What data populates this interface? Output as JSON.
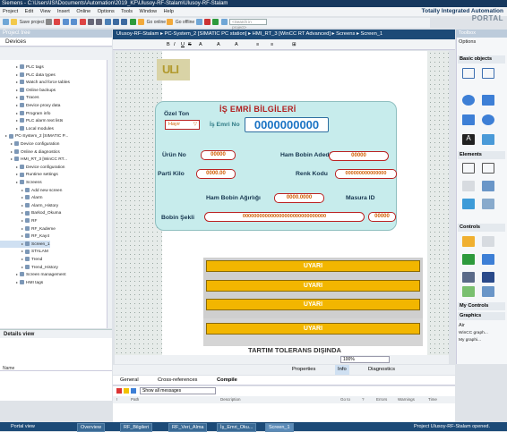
{
  "window": {
    "title": "Siemens - C:\\Users\\ISI\\Documents\\Automation\\2019_KF\\Ulusoy-RF-Stalam\\Ulusoy-RF-Stalam"
  },
  "menu": [
    "Project",
    "Edit",
    "View",
    "Insert",
    "Online",
    "Options",
    "Tools",
    "Window",
    "Help"
  ],
  "brand": {
    "line1": "Totally Integrated Automation",
    "line2": "PORTAL"
  },
  "toolbar": {
    "save": "Save project",
    "go_online": "Go online",
    "go_offline": "Go offline",
    "search_placeholder": "<Search in project>"
  },
  "project_panel": {
    "title": "Project tree",
    "devices_tab": "Devices"
  },
  "tree": [
    {
      "label": "PLC tags",
      "indent": 2
    },
    {
      "label": "PLC data types",
      "indent": 2
    },
    {
      "label": "Watch and force tables",
      "indent": 2
    },
    {
      "label": "Online backups",
      "indent": 2
    },
    {
      "label": "Traces",
      "indent": 2
    },
    {
      "label": "Device proxy data",
      "indent": 2
    },
    {
      "label": "Program info",
      "indent": 2
    },
    {
      "label": "PLC alarm text lists",
      "indent": 2
    },
    {
      "label": "Local modules",
      "indent": 2
    },
    {
      "label": "PC-System_2 [SIMATIC P...",
      "indent": 0
    },
    {
      "label": "Device configuration",
      "indent": 1
    },
    {
      "label": "Online & diagnostics",
      "indent": 1
    },
    {
      "label": "HMI_RT_3 [WinCC RT...",
      "indent": 1
    },
    {
      "label": "Device configuration",
      "indent": 2
    },
    {
      "label": "Runtime settings",
      "indent": 2
    },
    {
      "label": "Screens",
      "indent": 2
    },
    {
      "label": "Add new screen",
      "indent": 3
    },
    {
      "label": "Alarm",
      "indent": 3
    },
    {
      "label": "Alarm_History",
      "indent": 3
    },
    {
      "label": "Barkod_Okuma",
      "indent": 3
    },
    {
      "label": "RF",
      "indent": 3
    },
    {
      "label": "RF_Kademe",
      "indent": 3
    },
    {
      "label": "RF_Kayıt",
      "indent": 3
    },
    {
      "label": "Screen_1",
      "indent": 3
    },
    {
      "label": "STALAM",
      "indent": 3
    },
    {
      "label": "Trend",
      "indent": 3
    },
    {
      "label": "Trend_History",
      "indent": 3
    },
    {
      "label": "Screen management",
      "indent": 2
    },
    {
      "label": "HMI tags",
      "indent": 2
    }
  ],
  "details": {
    "title": "Details view",
    "name_col": "Name"
  },
  "editor": {
    "breadcrumb": "Ulusoy-RF-Stalam  ▸  PC-System_2 [SIMATIC PC station]  ▸  HMI_RT_3 [WinCC RT Advanced]  ▸  Screens  ▸  Screen_1",
    "zoom": "100%"
  },
  "screen": {
    "title": "İŞ EMRİ BİLGİLERİ",
    "ozel_ton_label": "Özel Ton",
    "ozel_ton_value": "Hayır",
    "is_emri_label": "İş Emri No",
    "is_emri_value": "0000000000",
    "urun_no_label": "Ürün No",
    "urun_no_value": "00000",
    "ham_bobin_adedi_label": "Ham Bobin Adedi",
    "ham_bobin_adedi_value": "00000",
    "parti_kilo_label": "Parti Kilo",
    "parti_kilo_value": "0000.00",
    "renk_kodu_label": "Renk Kodu",
    "renk_kodu_value": "000000000000000",
    "ham_bobin_agirligi_label": "Ham Bobin Ağırlığı",
    "ham_bobin_agirligi_value": "0000.0000",
    "masura_id_label": "Masura ID",
    "bobin_sekli_label": "Bobin Şekli",
    "bobin_sekli_value": "000000000000000000000000000000",
    "masura_id_value": "00000",
    "warnings": [
      "UYARI",
      "UYARI",
      "UYARI",
      "UYARI"
    ],
    "tartim": "TARTIM TOLERANS DIŞINDA"
  },
  "bottom": {
    "properties": "Properties",
    "info": "Info",
    "diagnostics": "Diagnostics",
    "general": "General",
    "cross_refs": "Cross-references",
    "compile": "Compile",
    "show_all": "Show all messages",
    "cols": [
      "!",
      "Path",
      "Description",
      "Go to",
      "?",
      "Errors",
      "Warnings",
      "Time"
    ]
  },
  "right_panel": {
    "tools_title": "Toolbox",
    "options": "Options",
    "basic_objects": "Basic objects",
    "elements": "Elements",
    "controls": "Controls",
    "my_controls": "My Controls",
    "graphics": "Graphics",
    "graphics_items": [
      "Air",
      "WinCC graph...",
      "My graphi..."
    ]
  },
  "statusbar": {
    "portal_view": "Portal view",
    "tabs": [
      "Overview",
      "RF_Bilgileri",
      "RF_Veri_Alma",
      "İş_Emri_Oku...",
      "Screen_1"
    ],
    "project_status": "Project Ulusoy-RF-Stalam opened."
  }
}
